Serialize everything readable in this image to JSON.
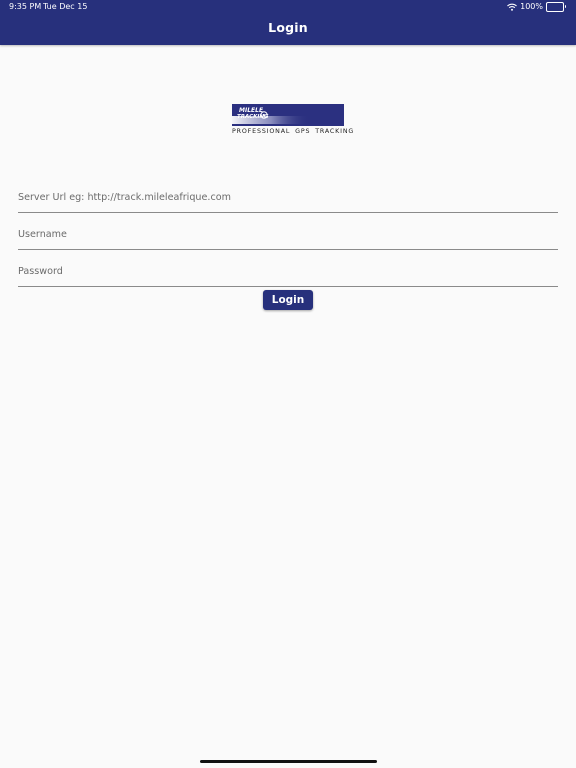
{
  "status_bar": {
    "time": "9:35 PM",
    "date": "Tue Dec 15",
    "battery_percent": "100%",
    "battery_level": 1.0,
    "icons": [
      "wifi-icon",
      "battery-icon"
    ]
  },
  "header": {
    "title": "Login"
  },
  "logo": {
    "brand_line1": "MILELE",
    "brand_line2": "TRACKING",
    "tagline": "PROFESSIONAL GPS TRACKING"
  },
  "form": {
    "server_url": {
      "placeholder": "Server Url eg: http://track.mileleafrique.com",
      "value": ""
    },
    "username": {
      "placeholder": "Username",
      "value": ""
    },
    "password": {
      "placeholder": "Password",
      "value": ""
    },
    "login_label": "Login"
  },
  "colors": {
    "header_bg": "#27307c",
    "button_bg": "#27307c",
    "page_bg": "#fafafa",
    "logo_bg": "#2b3080"
  }
}
